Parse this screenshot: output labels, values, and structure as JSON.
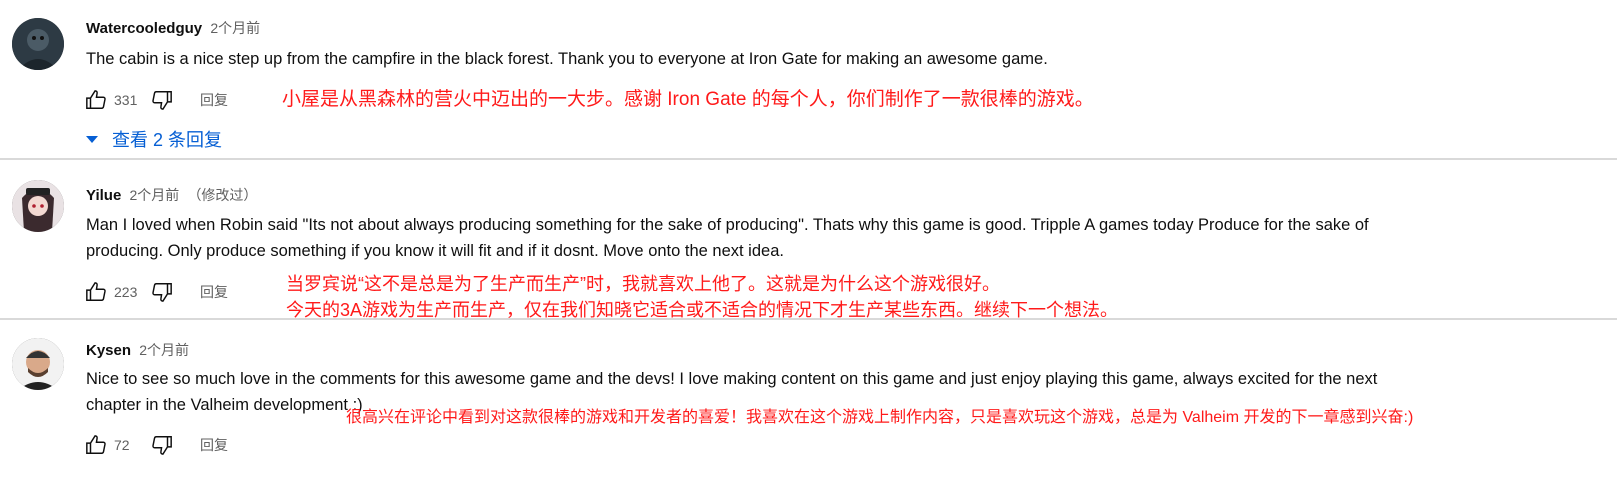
{
  "comments": [
    {
      "author": "Watercooledguy",
      "time": "2个月前",
      "edited": "",
      "text": "The cabin is a nice step up from the campfire in the black forest. Thank you to everyone at Iron Gate for making an awesome game.",
      "likes": "331",
      "reply_label": "回复",
      "annotation_lines": [
        "小屋是从黑森林的营火中迈出的一大步。感谢 Iron Gate 的每个人，你们制作了一款很棒的游戏。"
      ],
      "replies_label": "查看 2 条回复"
    },
    {
      "author": "Yilue",
      "time": "2个月前",
      "edited": "（修改过）",
      "text_lines": [
        "Man I loved when Robin said \"Its not about always producing something for the sake of producing\". Thats why this game is good. Tripple A games today Produce for the sake of",
        "producing. Only produce something if you know it will fit and if it dosnt. Move onto the next idea."
      ],
      "likes": "223",
      "reply_label": "回复",
      "annotation_lines": [
        "当罗宾说“这不是总是为了生产而生产”时，我就喜欢上他了。这就是为什么这个游戏很好。",
        "今天的3A游戏为生产而生产，仅在我们知晓它适合或不适合的情况下才生产某些东西。继续下一个想法。"
      ]
    },
    {
      "author": "Kysen",
      "time": "2个月前",
      "edited": "",
      "text_lines": [
        "Nice to see so much love in the comments for this awesome game and the devs! I love making content on this game and just enjoy playing this game, always excited for the next",
        "chapter in the Valheim development :)"
      ],
      "likes": "72",
      "reply_label": "回复",
      "annotation_lines": [
        "很高兴在评论中看到对这款很棒的游戏和开发者的喜爱！我喜欢在这个游戏上制作内容，只是喜欢玩这个游戏，总是为 Valheim 开发的下一章感到兴奋:)"
      ]
    }
  ],
  "colors": {
    "annotation": "#ff1a1a",
    "link": "#065fd4",
    "meta": "#606060"
  }
}
